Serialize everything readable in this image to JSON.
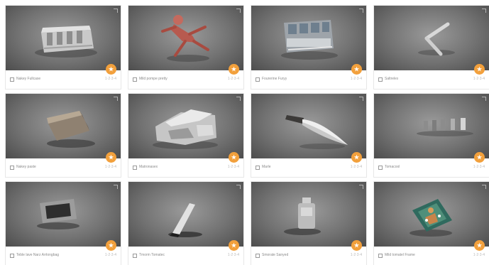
{
  "grid": {
    "cards": [
      {
        "title": "Nakey Fullcase",
        "stats": "1·2·3·4",
        "badge": "★",
        "model_icon": "cube-icon"
      },
      {
        "title": "Mild pompe pretty",
        "stats": "1·2·3·4",
        "badge": "★",
        "model_icon": "cube-icon"
      },
      {
        "title": "Fourerine Furyy",
        "stats": "1·2·3·4",
        "badge": "★",
        "model_icon": "cube-icon"
      },
      {
        "title": "Saltreles",
        "stats": "1·2·3·4",
        "badge": "★",
        "model_icon": "cube-icon"
      },
      {
        "title": "Nakey paste",
        "stats": "1·2·3·4",
        "badge": "★",
        "model_icon": "cube-icon"
      },
      {
        "title": "Matronasex",
        "stats": "1·2·3·4",
        "badge": "★",
        "model_icon": "cube-icon"
      },
      {
        "title": "Marle",
        "stats": "1·2·3·4",
        "badge": "★",
        "model_icon": "cube-icon"
      },
      {
        "title": "Tomacool",
        "stats": "1·2·3·4",
        "badge": "★",
        "model_icon": "cube-icon"
      },
      {
        "title": "Teble lave Narz Arrlongbag",
        "stats": "1·2·3·4",
        "badge": "★",
        "model_icon": "cube-icon"
      },
      {
        "title": "Tmorm Tomatec",
        "stats": "1·2·3·4",
        "badge": "★",
        "model_icon": "cube-icon"
      },
      {
        "title": "Smorate Sanyed",
        "stats": "1·2·3·4",
        "badge": "★",
        "model_icon": "cube-icon"
      },
      {
        "title": "Mild tomatel Frame",
        "stats": "1·2·3·4",
        "badge": "★",
        "model_icon": "cube-icon"
      }
    ]
  },
  "colors": {
    "thumb_bg": "#727272",
    "badge": "#f2a03c",
    "caption_text": "#8a8a8a"
  }
}
